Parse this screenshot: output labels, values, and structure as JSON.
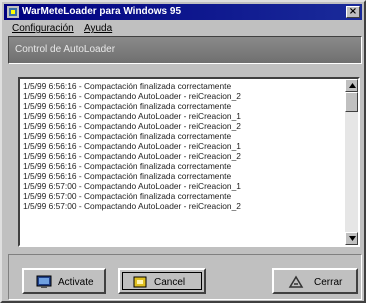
{
  "window": {
    "title": "WarMeteLoader para Windows 95"
  },
  "menu": {
    "items": [
      "Configuración",
      "Ayuda"
    ]
  },
  "panel": {
    "title": "Control de AutoLoader"
  },
  "log": {
    "lines": [
      "1/5/99 6:56:16 - Compactación finalizada correctamente",
      "1/5/99 6:56:16 - Compactando AutoLoader - reiCreacion_2",
      "1/5/99 6:56:16 - Compactación finalizada correctamente",
      "1/5/99 6:56:16 - Compactando AutoLoader - reiCreacion_1",
      "1/5/99 6:56:16 - Compactando AutoLoader - reiCreacion_2",
      "1/5/99 6:56:16 - Compactación finalizada correctamente",
      "1/5/99 6:56:16 - Compactando AutoLoader - reiCreacion_1",
      "1/5/99 6:56:16 - Compactando AutoLoader - reiCreacion_2",
      "1/5/99 6:56:16 - Compactación finalizada correctamente",
      "1/5/99 6:56:16 - Compactación finalizada correctamente",
      "1/5/99 6:57:00 - Compactando AutoLoader - reiCreacion_1",
      "1/5/99 6:57:00 - Compactación finalizada correctamente",
      "1/5/99 6:57:00 - Compactando AutoLoader - reiCreacion_2"
    ]
  },
  "buttons": {
    "activate": "Activate",
    "cancel": "Cancel",
    "close": "Cerrar"
  },
  "colors": {
    "titlebar": "#000080",
    "face": "#c0c0c0"
  },
  "icons": {
    "app": "app-icon",
    "close": "close-icon",
    "activate": "activate-icon",
    "cancel": "cancel-icon",
    "exit": "exit-icon"
  }
}
